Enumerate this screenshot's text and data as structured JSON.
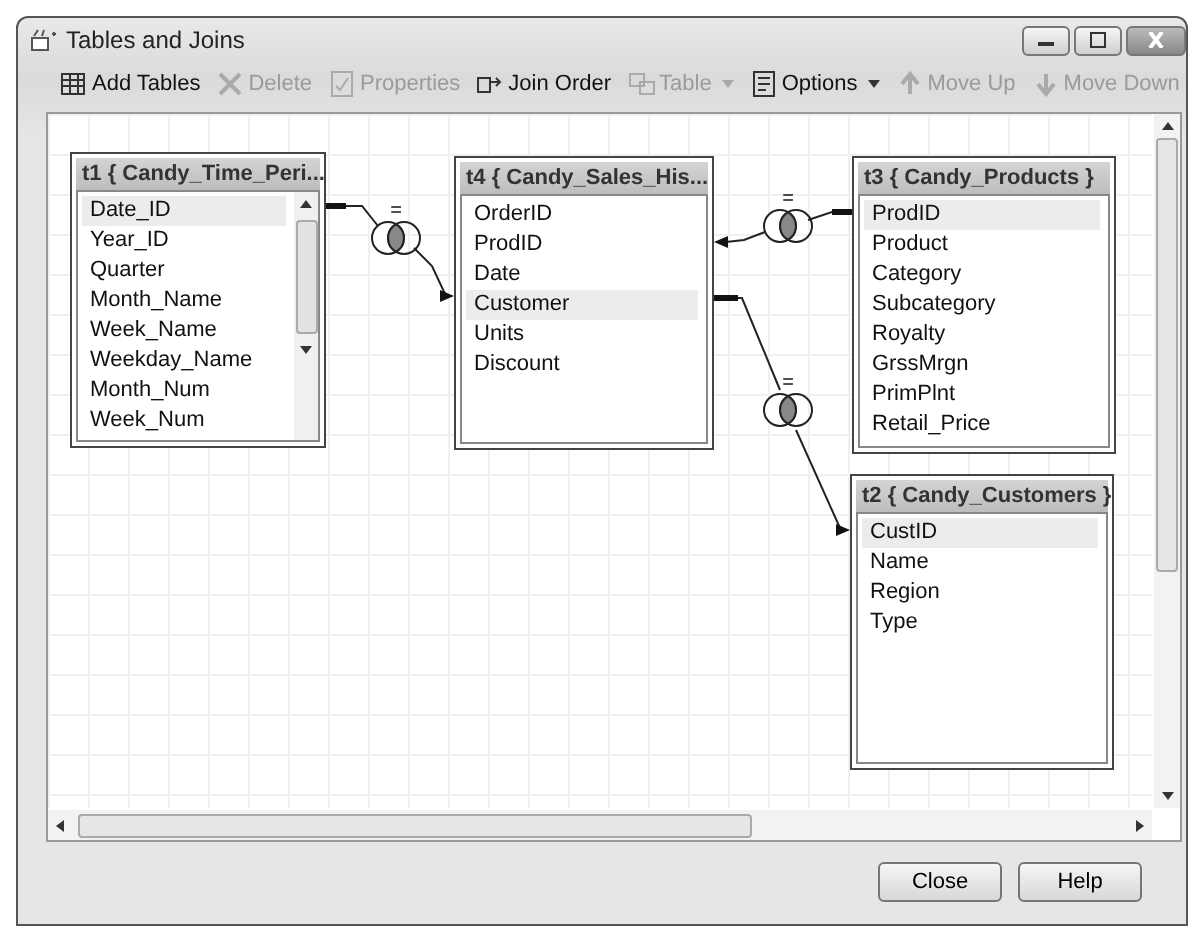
{
  "window": {
    "title": "Tables and Joins"
  },
  "toolbar": [
    {
      "label": "Add Tables",
      "disabled": false,
      "dropdown": false
    },
    {
      "label": "Delete",
      "disabled": true,
      "dropdown": false
    },
    {
      "label": "Properties",
      "disabled": true,
      "dropdown": false
    },
    {
      "label": "Join Order",
      "disabled": false,
      "dropdown": false
    },
    {
      "label": "Table",
      "disabled": true,
      "dropdown": true
    },
    {
      "label": "Options",
      "disabled": false,
      "dropdown": true
    },
    {
      "label": "Move Up",
      "disabled": true,
      "dropdown": false
    },
    {
      "label": "Move Down",
      "disabled": true,
      "dropdown": false
    }
  ],
  "tables": [
    {
      "title": "t1 { Candy_Time_Peri...",
      "scrollable": true,
      "fields": [
        {
          "name": "Date_ID",
          "selected": true
        },
        {
          "name": "Year_ID",
          "selected": false
        },
        {
          "name": "Quarter",
          "selected": false
        },
        {
          "name": "Month_Name",
          "selected": false
        },
        {
          "name": "Week_Name",
          "selected": false
        },
        {
          "name": "Weekday_Name",
          "selected": false
        },
        {
          "name": "Month_Num",
          "selected": false
        },
        {
          "name": "Week_Num",
          "selected": false
        }
      ]
    },
    {
      "title": "t4 { Candy_Sales_His...",
      "scrollable": false,
      "fields": [
        {
          "name": "OrderID",
          "selected": false
        },
        {
          "name": "ProdID",
          "selected": false
        },
        {
          "name": "Date",
          "selected": false
        },
        {
          "name": "Customer",
          "selected": true
        },
        {
          "name": "Units",
          "selected": false
        },
        {
          "name": "Discount",
          "selected": false
        }
      ]
    },
    {
      "title": "t3 { Candy_Products }",
      "scrollable": false,
      "fields": [
        {
          "name": "ProdID",
          "selected": true
        },
        {
          "name": "Product",
          "selected": false
        },
        {
          "name": "Category",
          "selected": false
        },
        {
          "name": "Subcategory",
          "selected": false
        },
        {
          "name": "Royalty",
          "selected": false
        },
        {
          "name": "GrssMrgn",
          "selected": false
        },
        {
          "name": "PrimPlnt",
          "selected": false
        },
        {
          "name": "Retail_Price",
          "selected": false
        }
      ]
    },
    {
      "title": "t2 { Candy_Customers }",
      "scrollable": false,
      "fields": [
        {
          "name": "CustID",
          "selected": true
        },
        {
          "name": "Name",
          "selected": false
        },
        {
          "name": "Region",
          "selected": false
        },
        {
          "name": "Type",
          "selected": false
        }
      ]
    }
  ],
  "joins": [
    {
      "operator": "="
    },
    {
      "operator": "="
    },
    {
      "operator": "="
    }
  ],
  "buttons": [
    "Close",
    "Help"
  ]
}
